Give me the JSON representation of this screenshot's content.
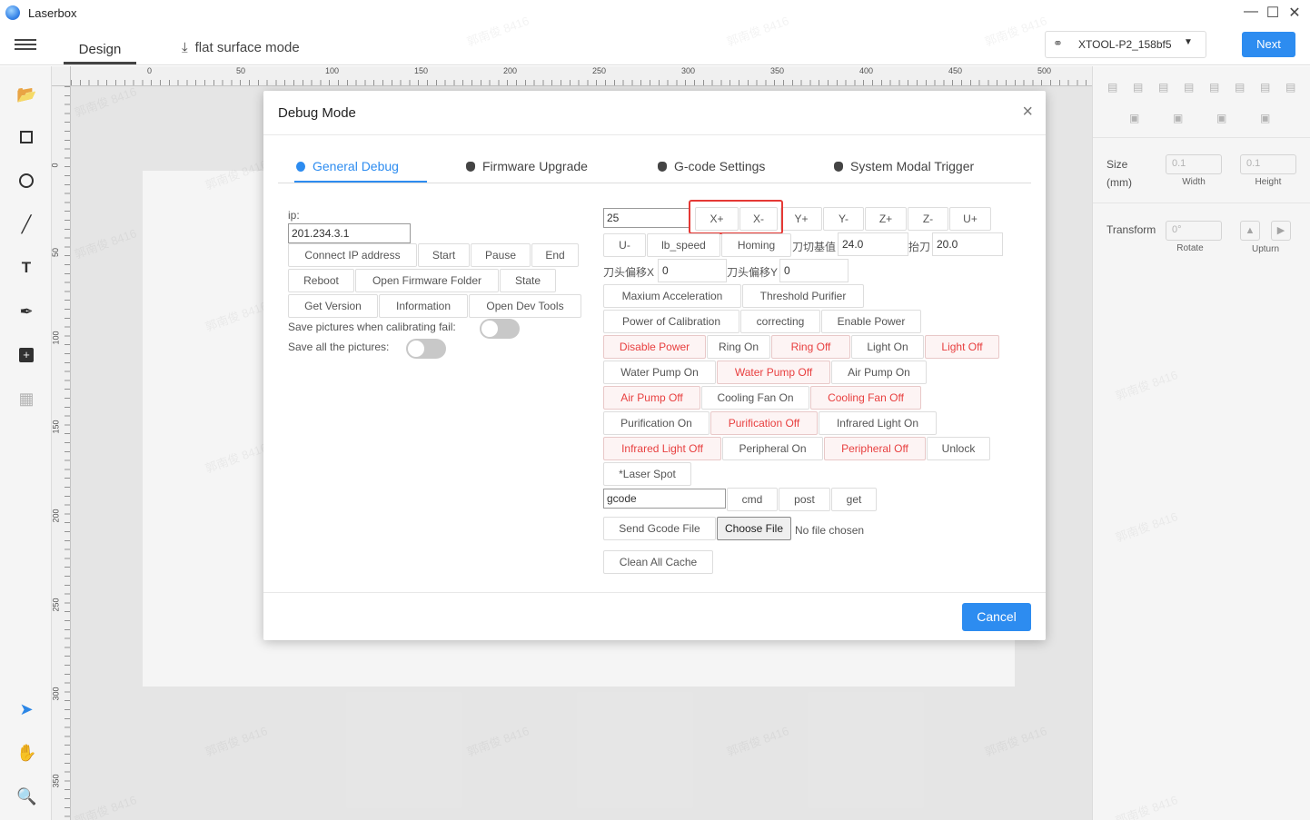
{
  "app": {
    "title": "Laserbox"
  },
  "header": {
    "tab_design": "Design",
    "tab_flat": "flat surface mode",
    "device": "XTOOL-P2_158bf5",
    "next": "Next"
  },
  "ruler": {
    "top": [
      "0",
      "50",
      "100",
      "150",
      "200",
      "250",
      "300",
      "350",
      "400",
      "450",
      "500"
    ],
    "left": [
      "0",
      "50",
      "100",
      "150",
      "200",
      "250",
      "300",
      "350"
    ]
  },
  "right_panel": {
    "size_label": "Size",
    "size_unit": "(mm)",
    "width_value": "0.1",
    "height_value": "0.1",
    "width_label": "Width",
    "height_label": "Height",
    "transform_label": "Transform",
    "rotate_value": "0°",
    "rotate_label": "Rotate",
    "upturn_label": "Upturn"
  },
  "dialog": {
    "title": "Debug Mode",
    "tabs": [
      "General Debug",
      "Firmware Upgrade",
      "G-code Settings",
      "System Modal Trigger"
    ],
    "ip_label": "ip:",
    "ip_value": "201.234.3.1",
    "left_buttons": {
      "connect": "Connect IP address",
      "start": "Start",
      "pause": "Pause",
      "end": "End",
      "reboot": "Reboot",
      "open_firmware": "Open Firmware Folder",
      "state": "State",
      "get_version": "Get Version",
      "information": "Information",
      "open_dev": "Open Dev Tools"
    },
    "save_calib_label": "Save pictures when calibrating fail:",
    "save_all_label": "Save all the pictures:",
    "step_value": "25",
    "axis": [
      "X+",
      "X-",
      "Y+",
      "Y-",
      "Z+",
      "Z-",
      "U+"
    ],
    "u_minus": "U-",
    "lb_speed": "lb_speed",
    "homing": "Homing",
    "cut_base_label": "刀切基值",
    "cut_base_value": "24.0",
    "knife_label": "抬刀",
    "knife_value": "20.0",
    "offset_x_label": "刀头偏移X",
    "offset_x_value": "0",
    "offset_y_label": "刀头偏移Y",
    "offset_y_value": "0",
    "buttons": {
      "max_accel": "Maxium Acceleration",
      "threshold": "Threshold Purifier",
      "power_calib": "Power of Calibration",
      "correcting": "correcting",
      "enable_power": "Enable Power",
      "disable_power": "Disable Power",
      "ring_on": "Ring On",
      "ring_off": "Ring Off",
      "light_on": "Light On",
      "light_off": "Light Off",
      "water_on": "Water Pump On",
      "water_off": "Water Pump Off",
      "air_on": "Air Pump On",
      "air_off": "Air Pump Off",
      "fan_on": "Cooling Fan On",
      "fan_off": "Cooling Fan Off",
      "purif_on": "Purification On",
      "purif_off": "Purification Off",
      "ir_on": "Infrared Light On",
      "ir_off": "Infrared Light Off",
      "periph_on": "Peripheral On",
      "periph_off": "Peripheral Off",
      "unlock": "Unlock",
      "laser_spot": "*Laser Spot",
      "cmd": "cmd",
      "post": "post",
      "get": "get",
      "send_gcode": "Send Gcode File",
      "choose_file": "Choose File",
      "clean_cache": "Clean All Cache"
    },
    "gcode_value": "gcode",
    "no_file": "No file chosen",
    "cancel": "Cancel"
  },
  "watermark": "郭南俊 8416",
  "colors": {
    "accent": "#2d8cf0",
    "danger": "#e84040",
    "highlight": "#e53935"
  }
}
